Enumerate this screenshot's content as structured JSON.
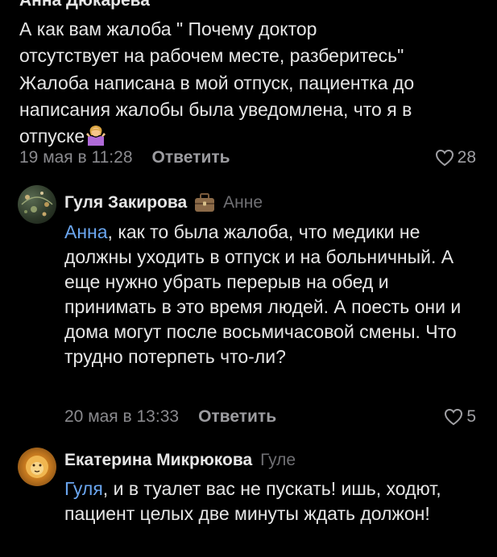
{
  "comment1": {
    "author": "Анна Дюкарева",
    "text_lines": [
      "А как вам жалоба \" Почему доктор",
      "отсутствует на рабочем месте, разберитесь\"",
      "Жалоба написана в мой отпуск, пациентка до",
      "написания жалобы была уведомлена, что я в",
      "отпуске"
    ],
    "emoji": "woman-shrugging-emoji",
    "date": "19 мая в 11:28",
    "reply_label": "Ответить",
    "likes": "28"
  },
  "comment2": {
    "author": "Гуля Закирова",
    "badge": "briefcase-icon",
    "reply_to": "Анне",
    "mention": "Анна",
    "text": ", как то была жалоба, что медики не должны уходить в отпуск и на больничный. А еще нужно убрать перерыв на обед и принимать в это время людей. А поесть они и дома могут после восьмичасовой смены. Что трудно потерпеть что-ли?",
    "date": "20 мая в 13:33",
    "reply_label": "Ответить",
    "likes": "5"
  },
  "comment3": {
    "author": "Екатерина Микрюкова",
    "reply_to": "Гуле",
    "mention": "Гуля",
    "text": ", и в туалет вас не пускать! ишь, ходют, пациент целых две минуты ждать должон!"
  },
  "colors": {
    "background": "#000000",
    "text": "#e6e6e6",
    "secondary": "#8a8a8e",
    "mention": "#6aa5ee"
  }
}
